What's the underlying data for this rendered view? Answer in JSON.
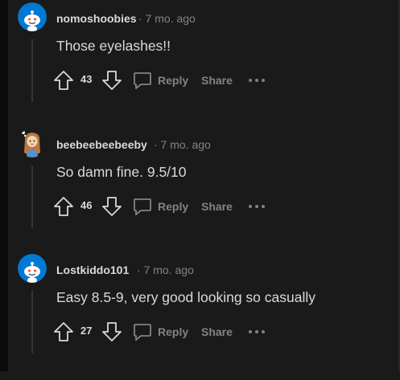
{
  "comments": [
    {
      "username": "nomoshoobies",
      "time": "· 7 mo. ago",
      "body": "Those eyelashes!!",
      "votes": "43",
      "reply_label": "Reply",
      "share_label": "Share",
      "avatar": "snoo-default-icon"
    },
    {
      "username": "beebeebeebeeby",
      "time": "· 7 mo. ago",
      "body": "So damn fine. 9.5/10",
      "votes": "46",
      "reply_label": "Reply",
      "share_label": "Share",
      "avatar": "custom-girl-avatar"
    },
    {
      "username": "Lostkiddo101",
      "time": "· 7 mo. ago",
      "body": "Easy 8.5-9, very good looking so casually",
      "votes": "27",
      "reply_label": "Reply",
      "share_label": "Share",
      "avatar": "snoo-default-icon"
    }
  ],
  "colors": {
    "background": "#1a1a1b",
    "text": "#d7dadc",
    "muted": "#818384",
    "avatar_blue": "#0079d3"
  }
}
